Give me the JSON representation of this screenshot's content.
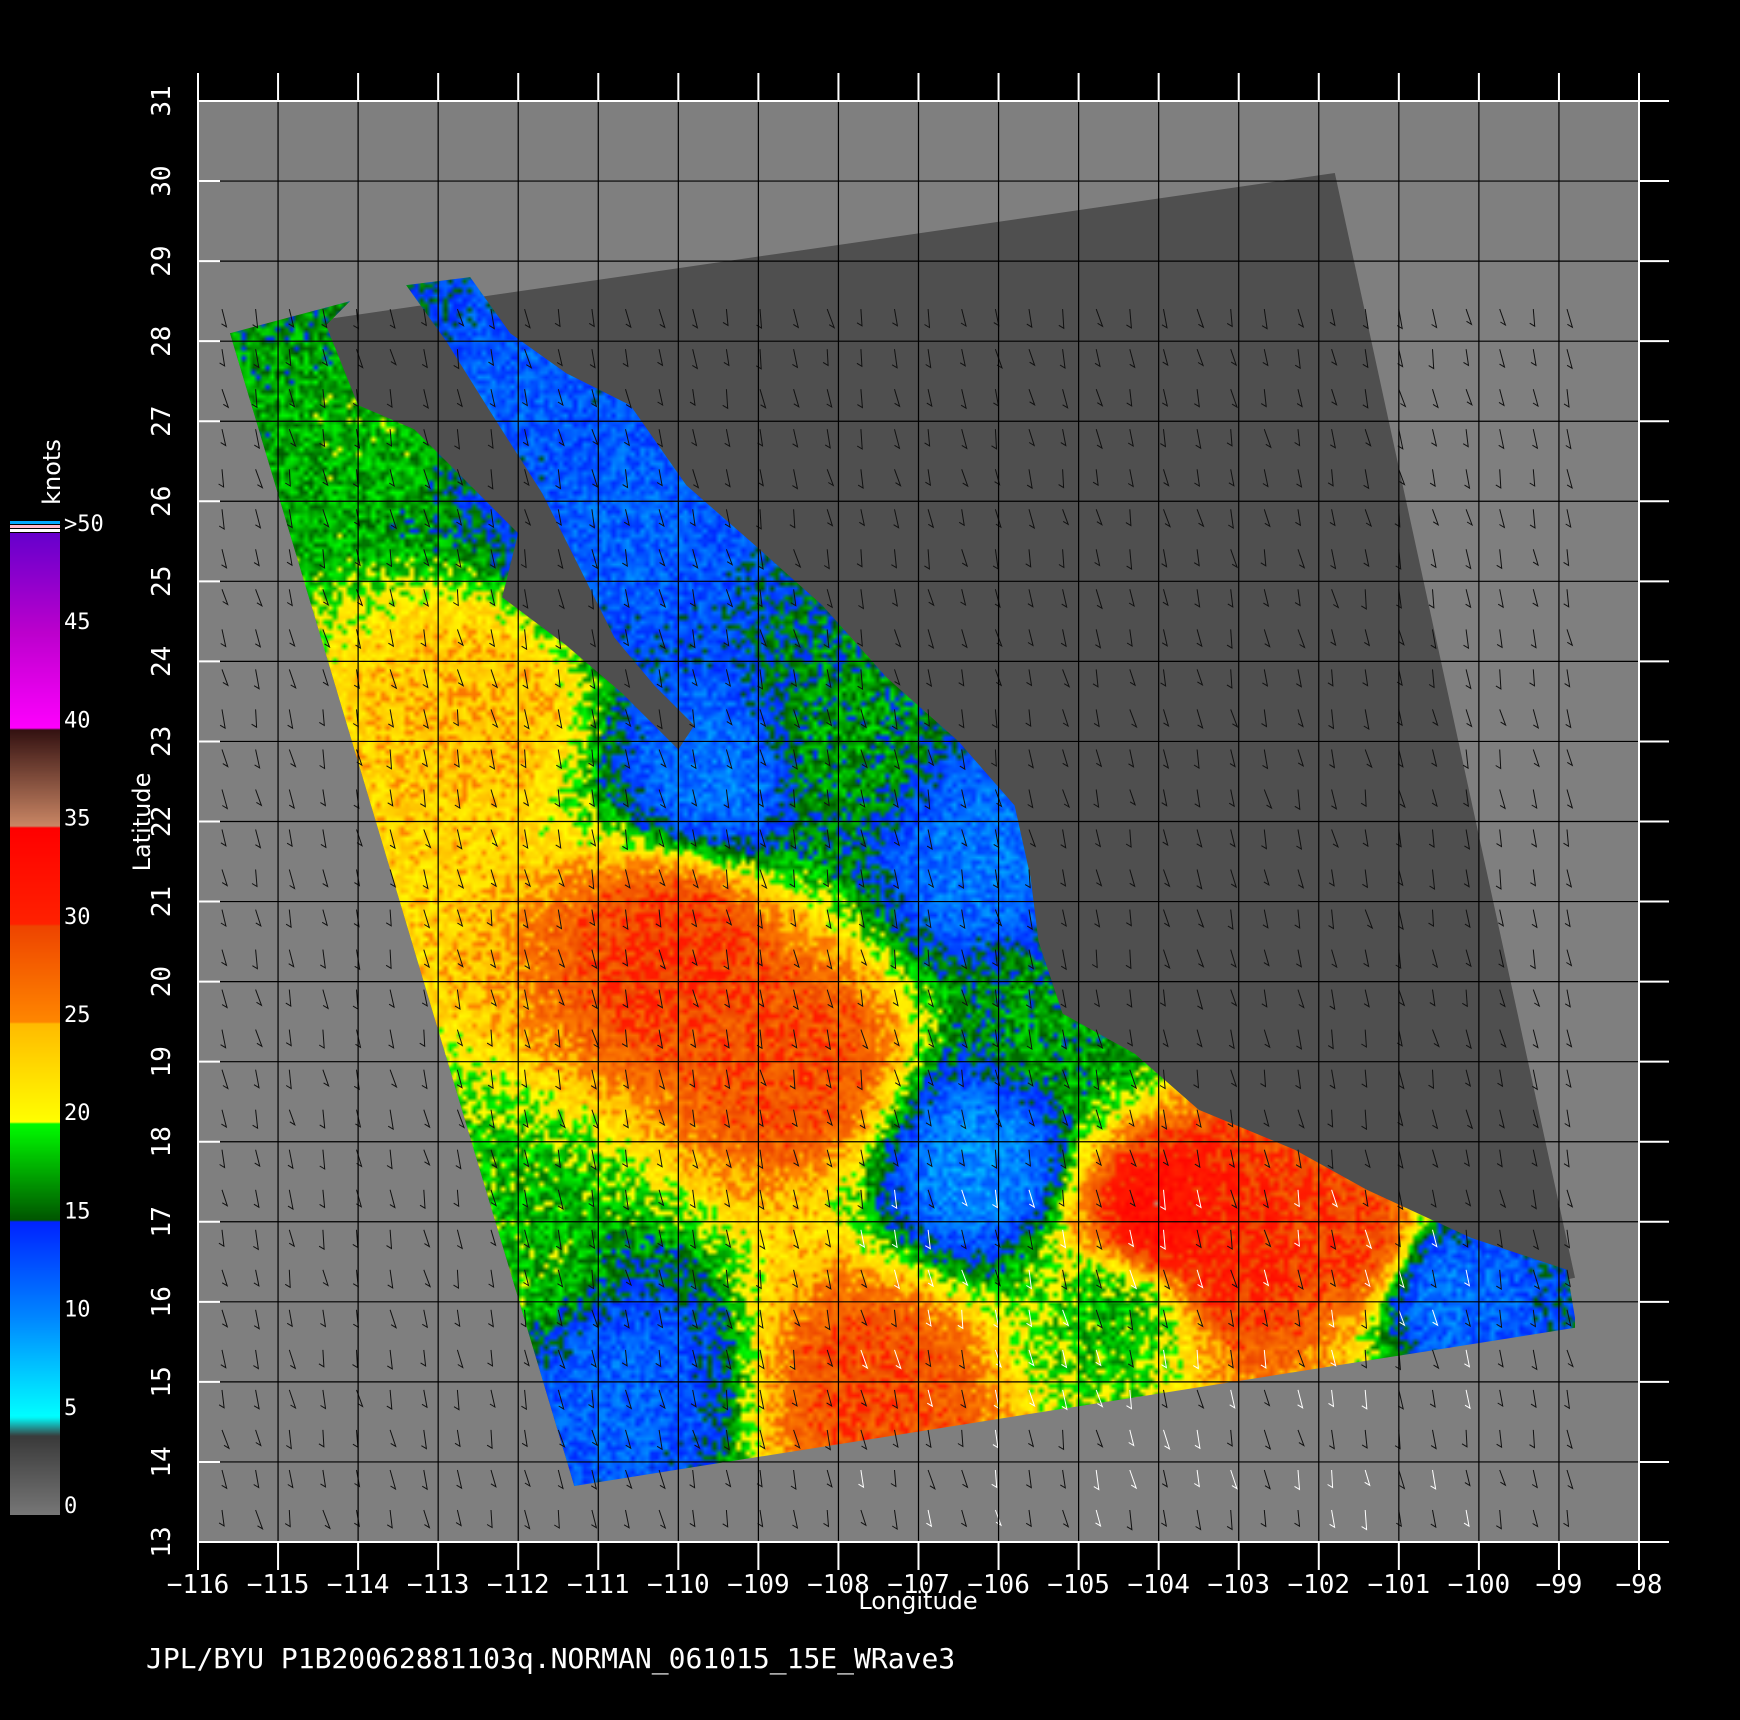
{
  "map": {
    "x_axis": {
      "title": "Longitude",
      "min": -116,
      "max": -98,
      "ticks": [
        -116,
        -115,
        -114,
        -113,
        -112,
        -111,
        -110,
        -109,
        -108,
        -107,
        -106,
        -105,
        -104,
        -103,
        -102,
        -101,
        -100,
        -99,
        -98
      ],
      "tick_labels": [
        "−116",
        "−115",
        "−114",
        "−113",
        "−112",
        "−111",
        "−110",
        "−109",
        "−108",
        "−107",
        "−106",
        "−105",
        "−104",
        "−103",
        "−102",
        "−101",
        "−100",
        "−99",
        "−98"
      ]
    },
    "y_axis": {
      "title": "Latitude",
      "min": 13,
      "max": 31,
      "ticks": [
        13,
        14,
        15,
        16,
        17,
        18,
        19,
        20,
        21,
        22,
        23,
        24,
        25,
        26,
        27,
        28,
        29,
        30,
        31
      ],
      "tick_labels": [
        "13",
        "14",
        "15",
        "16",
        "17",
        "18",
        "19",
        "20",
        "21",
        "22",
        "23",
        "24",
        "25",
        "26",
        "27",
        "28",
        "29",
        "30",
        "31"
      ]
    },
    "grid": true,
    "background_color": "#7f7f7f",
    "land_color": "#4f4f4f",
    "swath_corners_lonlat": [
      [
        -115.6,
        28.1
      ],
      [
        -101.8,
        30.1
      ],
      [
        -98.8,
        16.3
      ],
      [
        -111.3,
        13.7
      ]
    ],
    "coastline_lonlat": [
      [
        -115.6,
        28.1
      ],
      [
        -114.1,
        28.5
      ],
      [
        -114.4,
        28.2
      ],
      [
        -114.0,
        27.2
      ],
      [
        -113.3,
        26.9
      ],
      [
        -112.5,
        26.1
      ],
      [
        -112.0,
        25.6
      ],
      [
        -112.2,
        24.8
      ],
      [
        -111.4,
        24.2
      ],
      [
        -110.7,
        23.6
      ],
      [
        -110.0,
        22.9
      ],
      [
        -109.8,
        23.2
      ],
      [
        -110.3,
        23.7
      ],
      [
        -110.8,
        24.3
      ],
      [
        -111.2,
        25.1
      ],
      [
        -111.7,
        26.1
      ],
      [
        -112.4,
        27.2
      ],
      [
        -112.9,
        28.0
      ],
      [
        -113.4,
        28.7
      ],
      [
        -112.6,
        28.8
      ],
      [
        -112.1,
        28.1
      ],
      [
        -111.4,
        27.6
      ],
      [
        -110.6,
        27.2
      ],
      [
        -109.9,
        26.2
      ],
      [
        -109.1,
        25.5
      ],
      [
        -108.2,
        24.7
      ],
      [
        -107.4,
        23.8
      ],
      [
        -106.5,
        23.0
      ],
      [
        -105.8,
        22.2
      ],
      [
        -105.6,
        21.3
      ],
      [
        -105.5,
        20.5
      ],
      [
        -105.2,
        19.6
      ],
      [
        -104.3,
        19.1
      ],
      [
        -103.5,
        18.4
      ],
      [
        -102.3,
        17.9
      ],
      [
        -101.4,
        17.4
      ],
      [
        -100.1,
        16.8
      ],
      [
        -98.9,
        16.4
      ],
      [
        -98.8,
        15.8
      ]
    ]
  },
  "colorbar": {
    "title": "knots",
    "labels": [
      "0",
      "5",
      "10",
      "15",
      "20",
      "25",
      "30",
      "35",
      "40",
      "45",
      ">50"
    ],
    "stops": [
      {
        "v": 0,
        "c": "#777777"
      },
      {
        "v": 4,
        "c": "#3a3a3a"
      },
      {
        "v": 5,
        "c": "#00ffff"
      },
      {
        "v": 10,
        "c": "#0088ff"
      },
      {
        "v": 15,
        "c": "#0022ff"
      },
      {
        "v": 15.01,
        "c": "#005500"
      },
      {
        "v": 20,
        "c": "#00ff00"
      },
      {
        "v": 20.01,
        "c": "#ffff00"
      },
      {
        "v": 25,
        "c": "#ffbb00"
      },
      {
        "v": 25.01,
        "c": "#ff8800"
      },
      {
        "v": 30,
        "c": "#ee4400"
      },
      {
        "v": 30.01,
        "c": "#ff2200"
      },
      {
        "v": 35,
        "c": "#ff0000"
      },
      {
        "v": 35.01,
        "c": "#cc8866"
      },
      {
        "v": 40,
        "c": "#331111"
      },
      {
        "v": 40.01,
        "c": "#ff00ff"
      },
      {
        "v": 45,
        "c": "#bb00cc"
      },
      {
        "v": 50,
        "c": "#6600cc"
      }
    ]
  },
  "wind_zones": [
    {
      "lon": -112.4,
      "lat": 27.3,
      "speed": 12
    },
    {
      "lon": -110.7,
      "lat": 25.5,
      "speed": 12
    },
    {
      "lon": -109.5,
      "lat": 22.6,
      "speed": 11
    },
    {
      "lon": -106.2,
      "lat": 21.6,
      "speed": 11
    },
    {
      "lon": -106.2,
      "lat": 17.7,
      "speed": 10
    },
    {
      "lon": -110.7,
      "lat": 15.0,
      "speed": 12
    },
    {
      "lon": -100.5,
      "lat": 16.2,
      "speed": 11
    },
    {
      "lon": -112.5,
      "lat": 23.5,
      "speed": 24
    },
    {
      "lon": -110.0,
      "lat": 20.5,
      "speed": 30
    },
    {
      "lon": -108.5,
      "lat": 19.0,
      "speed": 29
    },
    {
      "lon": -104.0,
      "lat": 17.0,
      "speed": 33
    },
    {
      "lon": -103.0,
      "lat": 16.6,
      "speed": 31
    },
    {
      "lon": -101.5,
      "lat": 16.7,
      "speed": 30
    },
    {
      "lon": -107.5,
      "lat": 15.0,
      "speed": 29
    },
    {
      "lon": -113.5,
      "lat": 27.0,
      "speed": 18
    },
    {
      "lon": -108.0,
      "lat": 23.0,
      "speed": 17
    },
    {
      "lon": -112.0,
      "lat": 16.5,
      "speed": 18
    },
    {
      "lon": -105.0,
      "lat": 19.5,
      "speed": 17
    },
    {
      "lon": -104.5,
      "lat": 15.9,
      "speed": 18
    }
  ],
  "footer": "JPL/BYU  P1B20062881103q.NORMAN_061015_15E_WRave3"
}
